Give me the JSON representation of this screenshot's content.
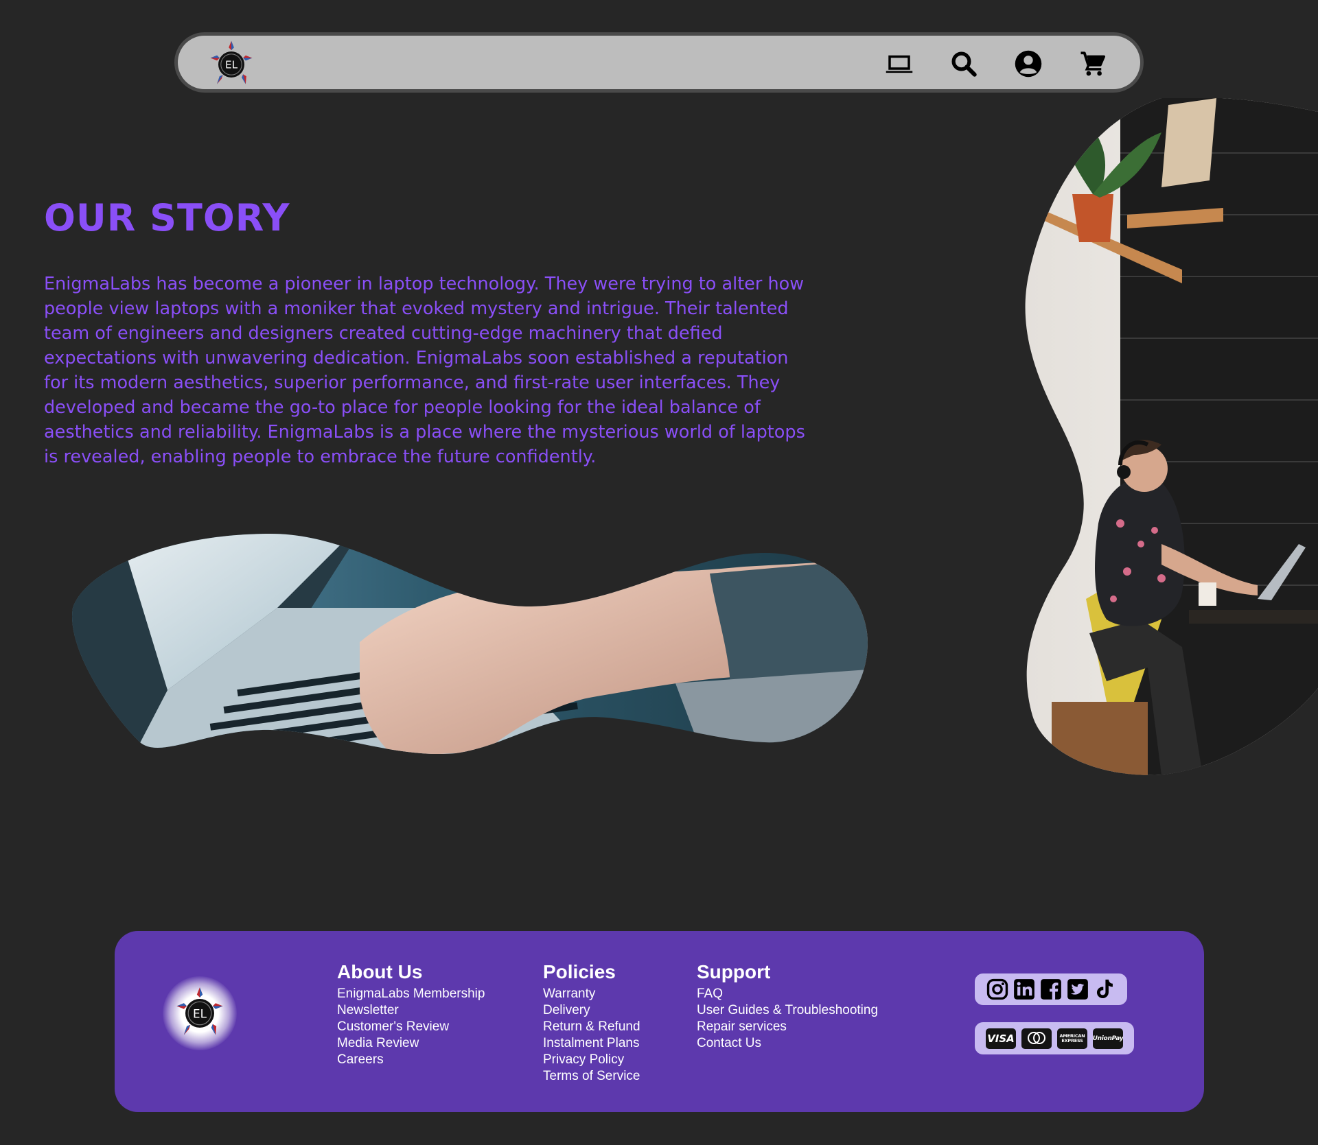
{
  "header": {
    "logo_text": "EL",
    "icons": [
      "laptop-icon",
      "search-icon",
      "account-icon",
      "cart-icon"
    ]
  },
  "story": {
    "title": "OUR STORY",
    "body": "EnigmaLabs has become a pioneer in laptop technology. They were trying to alter how people view laptops with a moniker that evoked mystery and intrigue. Their talented team of engineers and designers created cutting-edge machinery that defied expectations with unwavering dedication. EnigmaLabs soon established a reputation for its modern aesthetics, superior performance, and first-rate user interfaces. They developed and became the go-to place for people looking for the ideal balance of aesthetics and reliability. EnigmaLabs is a place where the mysterious world of laptops is revealed, enabling people to embrace the future confidently."
  },
  "footer": {
    "logo_text": "EL",
    "about": {
      "heading": "About Us",
      "links": [
        "EnigmaLabs Membership",
        "Newsletter",
        "Customer's Review",
        "Media Review",
        "Careers"
      ]
    },
    "policies": {
      "heading": "Policies",
      "links": [
        "Warranty",
        "Delivery",
        "Return & Refund",
        "Instalment Plans",
        "Privacy Policy",
        "Terms of Service"
      ]
    },
    "support": {
      "heading": "Support",
      "links": [
        "FAQ",
        "User Guides & Troubleshooting",
        "Repair services",
        "Contact Us"
      ]
    },
    "social_icons": [
      "instagram-icon",
      "linkedin-icon",
      "facebook-icon",
      "twitter-icon",
      "tiktok-icon"
    ],
    "payment_icons": [
      {
        "name": "visa-icon",
        "label": "VISA"
      },
      {
        "name": "mastercard-icon",
        "label": ""
      },
      {
        "name": "american-express-icon",
        "label": "AMERICAN EXPRESS"
      },
      {
        "name": "unionpay-icon",
        "label": "UnionPay"
      }
    ]
  },
  "colors": {
    "background": "#262626",
    "accent_purple": "#8a4ff7",
    "footer_purple": "#5d39ad",
    "navbar_gray": "#bdbdbd",
    "icon_box": "#c8bbf1"
  }
}
